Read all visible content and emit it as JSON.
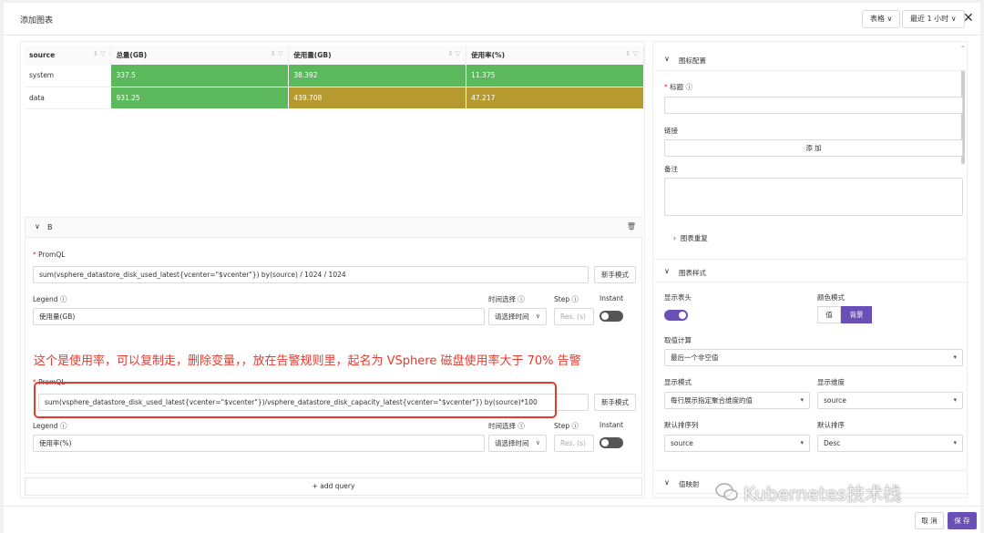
{
  "header": {
    "title": "添加图表",
    "view_select": "表格 ∨",
    "time_select": "最近 1 小时 ∨"
  },
  "table": {
    "columns": [
      "source",
      "总量(GB)",
      "使用量(GB)",
      "使用率(%)"
    ],
    "rows": [
      {
        "source": "system",
        "total": "337.5",
        "used": "38.392",
        "rate": "11.375"
      },
      {
        "source": "data",
        "total": "931.25",
        "used": "439.708",
        "rate": "47.217"
      }
    ]
  },
  "query": {
    "name": "B",
    "promql_label": "PromQL",
    "expr1": "sum(vsphere_datastore_disk_used_latest{vcenter=\"$vcenter\"}) by(source) / 1024 / 1024",
    "novice_mode": "新手模式",
    "legend_label": "Legend",
    "legend1": "使用量(GB)",
    "time_label": "时间选择",
    "time_placeholder": "请选择时间",
    "step_label": "Step",
    "step_placeholder": "Res. (s)",
    "instant_label": "Instant",
    "expr2": "sum(vsphere_datastore_disk_used_latest{vcenter=\"$vcenter\"})/vsphere_datastore_disk_capacity_latest{vcenter=\"$vcenter\"}) by(source)*100",
    "legend2": "使用率(%)",
    "add_query": "+ add query"
  },
  "annotation": "这个是使用率，可以复制走，删除变量，，放在告警规则里，起名为 VSphere 磁盘使用率大于 70% 告警",
  "config": {
    "section_panel": "图标配置",
    "title_label": "标题",
    "link_label": "链接",
    "add_label": "添 加",
    "note_label": "备注",
    "overlay_label": "图表重复",
    "section_style": "图表样式",
    "show_header_label": "显示表头",
    "color_mode_label": "颜色模式",
    "color_mode_value": "值",
    "color_mode_bg": "背景",
    "calc_label": "取值计算",
    "calc_value": "最后一个非空值",
    "display_mode_label": "显示模式",
    "display_mode_value": "每行展示指定聚合维度的值",
    "display_dim_label": "显示维度",
    "display_dim_value": "source",
    "sort_col_label": "默认排序列",
    "sort_col_value": "source",
    "sort_order_label": "默认排序",
    "sort_order_value": "Desc",
    "section_mapping": "值映射"
  },
  "footer": {
    "cancel": "取 消",
    "save": "保 存"
  },
  "watermark": "Kubernetes技术栈",
  "colors": {
    "green": "#5cb85c",
    "olive": "#b79a2f",
    "accent": "#6a4fb6",
    "annotation": "#e63a2e"
  }
}
